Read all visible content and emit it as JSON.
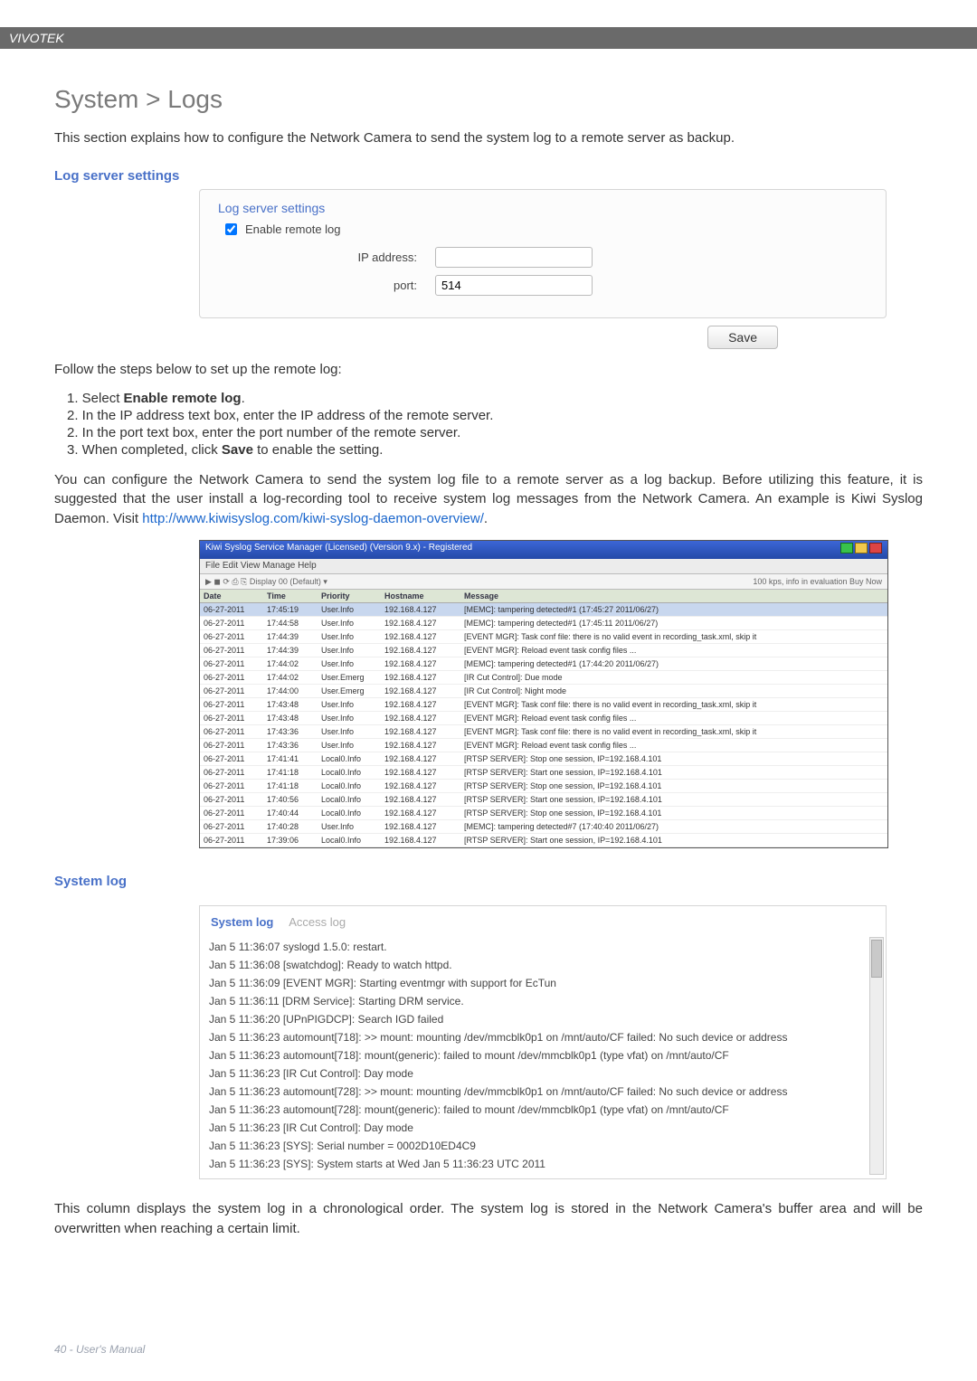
{
  "brand": "VIVOTEK",
  "page_title": "System > Logs",
  "intro": "This section explains how to configure the Network Camera to send the system log to a remote server as backup.",
  "log_server": {
    "heading": "Log server settings",
    "panel_title": "Log server settings",
    "enable_label": "Enable remote log",
    "fields": {
      "ip_label": "IP address:",
      "ip_value": "",
      "port_label": "port:",
      "port_value": "514"
    },
    "save_label": "Save"
  },
  "steps_intro": "Follow the steps below to set up the remote log:",
  "steps": [
    "Select Enable remote log.",
    "In the IP address text box, enter the IP address of the remote server.",
    "In the port text box, enter the port number of the remote server.",
    "When completed, click Save to enable the setting."
  ],
  "para_kiwi_a": "You can configure the Network Camera to send the system log file to a remote server as a log backup. Before utilizing this feature, it is suggested that the user install a log-recording tool to receive system log messages from the Network Camera. An example is Kiwi Syslog Daemon. Visit ",
  "kiwi_link_text": "http://www.kiwisyslog.com/kiwi-syslog-daemon-overview/",
  "para_kiwi_b": ".",
  "kiwi": {
    "title": "Kiwi Syslog Service Manager (Licensed) (Version 9.x) - Registered",
    "menu": "File  Edit  View  Manage  Help",
    "toolbar_left": "▶  ◼  ⟳  ⎙  ⎘   Display 00 (Default)  ▾",
    "toolbar_right": "100 kps, info in evaluation  Buy Now",
    "headers": {
      "date": "Date",
      "time": "Time",
      "priority": "Priority",
      "hostname": "Hostname",
      "message": "Message"
    },
    "rows": [
      {
        "date": "06-27-2011",
        "time": "17:45:19",
        "pri": "User.Info",
        "host": "192.168.4.127",
        "msg": "[MEMC]: tampering detected#1 (17:45:27 2011/06/27)",
        "sel": true
      },
      {
        "date": "06-27-2011",
        "time": "17:44:58",
        "pri": "User.Info",
        "host": "192.168.4.127",
        "msg": "[MEMC]: tampering detected#1 (17:45:11 2011/06/27)"
      },
      {
        "date": "06-27-2011",
        "time": "17:44:39",
        "pri": "User.Info",
        "host": "192.168.4.127",
        "msg": "[EVENT MGR]: Task conf file: there is no valid event in recording_task.xml, skip it"
      },
      {
        "date": "06-27-2011",
        "time": "17:44:39",
        "pri": "User.Info",
        "host": "192.168.4.127",
        "msg": "[EVENT MGR]: Reload event task config files ..."
      },
      {
        "date": "06-27-2011",
        "time": "17:44:02",
        "pri": "User.Info",
        "host": "192.168.4.127",
        "msg": "[MEMC]: tampering detected#1 (17:44:20 2011/06/27)"
      },
      {
        "date": "06-27-2011",
        "time": "17:44:02",
        "pri": "User.Emerg",
        "host": "192.168.4.127",
        "msg": "[IR Cut Control]: Due mode"
      },
      {
        "date": "06-27-2011",
        "time": "17:44:00",
        "pri": "User.Emerg",
        "host": "192.168.4.127",
        "msg": "[IR Cut Control]: Night mode"
      },
      {
        "date": "06-27-2011",
        "time": "17:43:48",
        "pri": "User.Info",
        "host": "192.168.4.127",
        "msg": "[EVENT MGR]: Task conf file: there is no valid event in recording_task.xml, skip it"
      },
      {
        "date": "06-27-2011",
        "time": "17:43:48",
        "pri": "User.Info",
        "host": "192.168.4.127",
        "msg": "[EVENT MGR]: Reload event task config files ..."
      },
      {
        "date": "06-27-2011",
        "time": "17:43:36",
        "pri": "User.Info",
        "host": "192.168.4.127",
        "msg": "[EVENT MGR]: Task conf file: there is no valid event in recording_task.xml, skip it"
      },
      {
        "date": "06-27-2011",
        "time": "17:43:36",
        "pri": "User.Info",
        "host": "192.168.4.127",
        "msg": "[EVENT MGR]: Reload event task config files ..."
      },
      {
        "date": "06-27-2011",
        "time": "17:41:41",
        "pri": "Local0.Info",
        "host": "192.168.4.127",
        "msg": "[RTSP SERVER]: Stop one session, IP=192.168.4.101"
      },
      {
        "date": "06-27-2011",
        "time": "17:41:18",
        "pri": "Local0.Info",
        "host": "192.168.4.127",
        "msg": "[RTSP SERVER]: Start one session, IP=192.168.4.101"
      },
      {
        "date": "06-27-2011",
        "time": "17:41:18",
        "pri": "Local0.Info",
        "host": "192.168.4.127",
        "msg": "[RTSP SERVER]: Stop one session, IP=192.168.4.101"
      },
      {
        "date": "06-27-2011",
        "time": "17:40:56",
        "pri": "Local0.Info",
        "host": "192.168.4.127",
        "msg": "[RTSP SERVER]: Start one session, IP=192.168.4.101"
      },
      {
        "date": "06-27-2011",
        "time": "17:40:44",
        "pri": "Local0.Info",
        "host": "192.168.4.127",
        "msg": "[RTSP SERVER]: Stop one session, IP=192.168.4.101"
      },
      {
        "date": "06-27-2011",
        "time": "17:40:28",
        "pri": "User.Info",
        "host": "192.168.4.127",
        "msg": "[MEMC]: tampering detected#7 (17:40:40 2011/06/27)"
      },
      {
        "date": "06-27-2011",
        "time": "17:39:06",
        "pri": "Local0.Info",
        "host": "192.168.4.127",
        "msg": "[RTSP SERVER]: Start one session, IP=192.168.4.101"
      }
    ]
  },
  "system_log": {
    "heading": "System log",
    "tab_active": "System log",
    "tab_inactive": "Access log",
    "lines": [
      "Jan 5 11:36:07 syslogd 1.5.0: restart.",
      "Jan 5 11:36:08 [swatchdog]: Ready to watch httpd.",
      "Jan 5 11:36:09 [EVENT MGR]: Starting eventmgr with support for EcTun",
      "Jan 5 11:36:11 [DRM Service]: Starting DRM service.",
      "Jan 5 11:36:20 [UPnPIGDCP]: Search IGD failed",
      "Jan 5 11:36:23 automount[718]: >> mount: mounting /dev/mmcblk0p1 on /mnt/auto/CF failed: No such device or address",
      "Jan 5 11:36:23 automount[718]: mount(generic): failed to mount /dev/mmcblk0p1 (type vfat) on /mnt/auto/CF",
      "Jan 5 11:36:23 [IR Cut Control]: Day mode",
      "Jan 5 11:36:23 automount[728]: >> mount: mounting /dev/mmcblk0p1 on /mnt/auto/CF failed: No such device or address",
      "Jan 5 11:36:23 automount[728]: mount(generic): failed to mount /dev/mmcblk0p1 (type vfat) on /mnt/auto/CF",
      "Jan 5 11:36:23 [IR Cut Control]: Day mode",
      "Jan 5 11:36:23 [SYS]: Serial number = 0002D10ED4C9",
      "Jan 5 11:36:23 [SYS]: System starts at Wed Jan 5 11:36:23 UTC 2011"
    ]
  },
  "closing_para": "This column displays the system log in a chronological order. The system log is stored in the Network Camera's buffer area and will be overwritten when reaching a certain limit.",
  "footer": "40 - User's Manual"
}
